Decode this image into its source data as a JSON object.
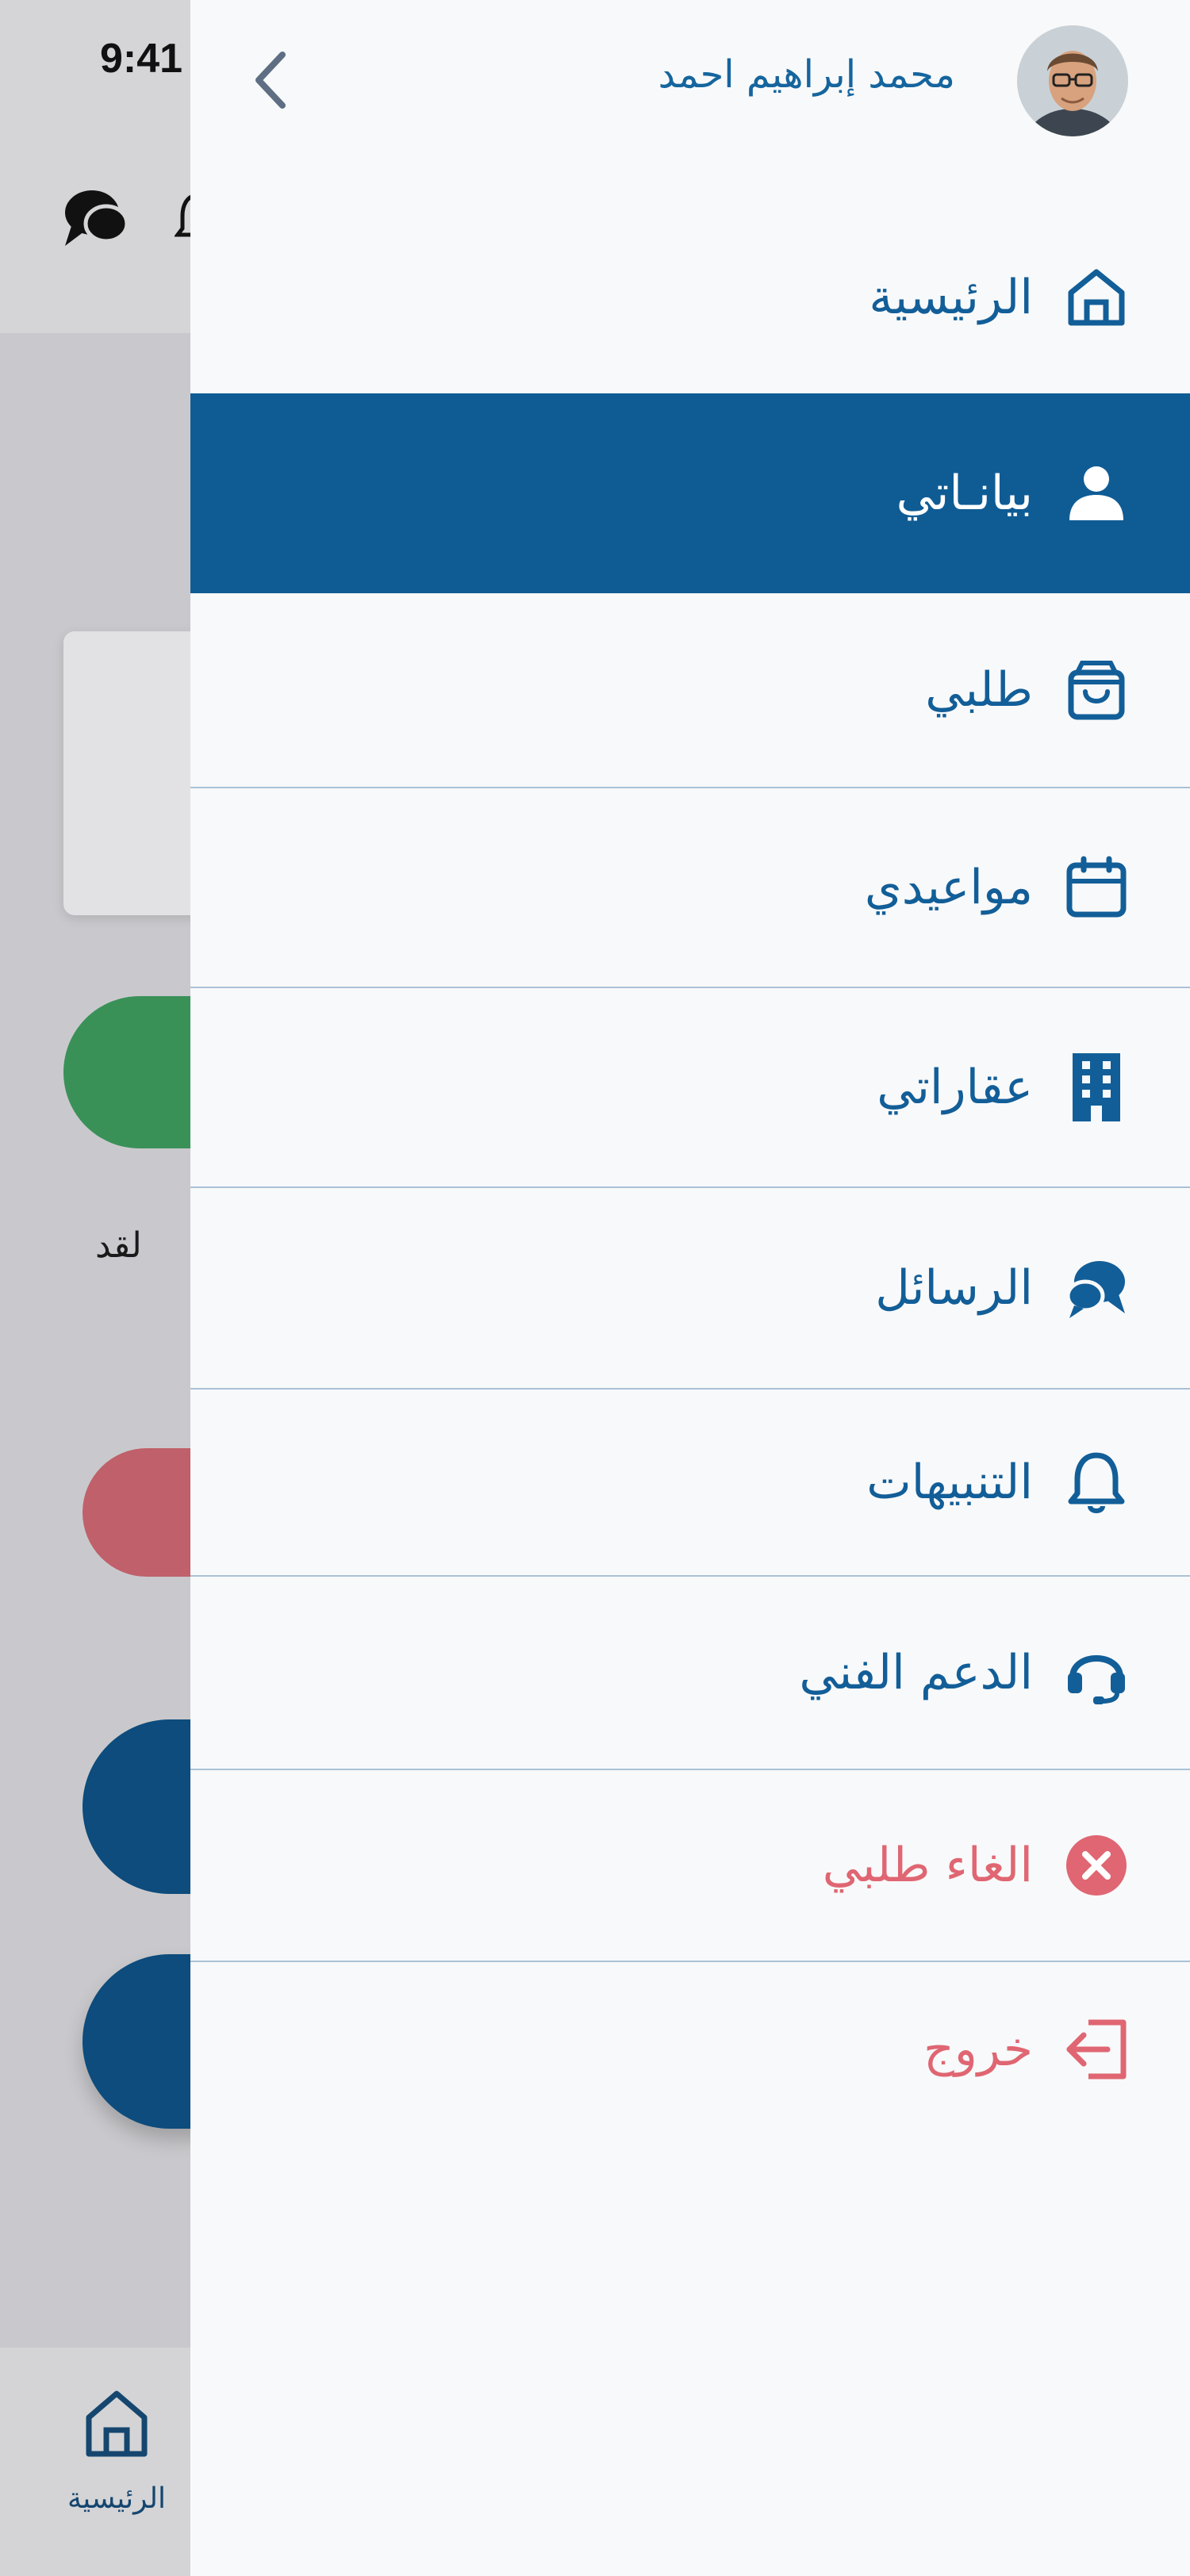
{
  "status_bar": {
    "time": "9:41"
  },
  "background": {
    "text_snippet": "لقد",
    "tab_home_label": "الرئيسية"
  },
  "drawer": {
    "user_name": "محمد إبراهيم احمد",
    "menu": [
      {
        "label": "الرئيسية",
        "icon": "home-icon",
        "state": "normal"
      },
      {
        "label": "بيانـاتي",
        "icon": "user-icon",
        "state": "active"
      },
      {
        "label": "طلبي",
        "icon": "bag-icon",
        "state": "normal"
      },
      {
        "label": "مواعيدي",
        "icon": "calendar-icon",
        "state": "normal"
      },
      {
        "label": "عقاراتي",
        "icon": "building-icon",
        "state": "normal"
      },
      {
        "label": "الرسائل",
        "icon": "chat-icon",
        "state": "normal"
      },
      {
        "label": "التنبيهات",
        "icon": "bell-icon",
        "state": "normal"
      },
      {
        "label": "الدعم الفني",
        "icon": "headset-icon",
        "state": "normal"
      },
      {
        "label": "الغاء طلبي",
        "icon": "cancel-icon",
        "state": "danger"
      },
      {
        "label": "خروج",
        "icon": "logout-icon",
        "state": "danger"
      }
    ]
  },
  "colors": {
    "primary": "#125e98",
    "active_bg": "#0f5c95",
    "danger": "#df6672",
    "divider": "#a9c2d6",
    "drawer_bg": "#f8f9fa"
  }
}
